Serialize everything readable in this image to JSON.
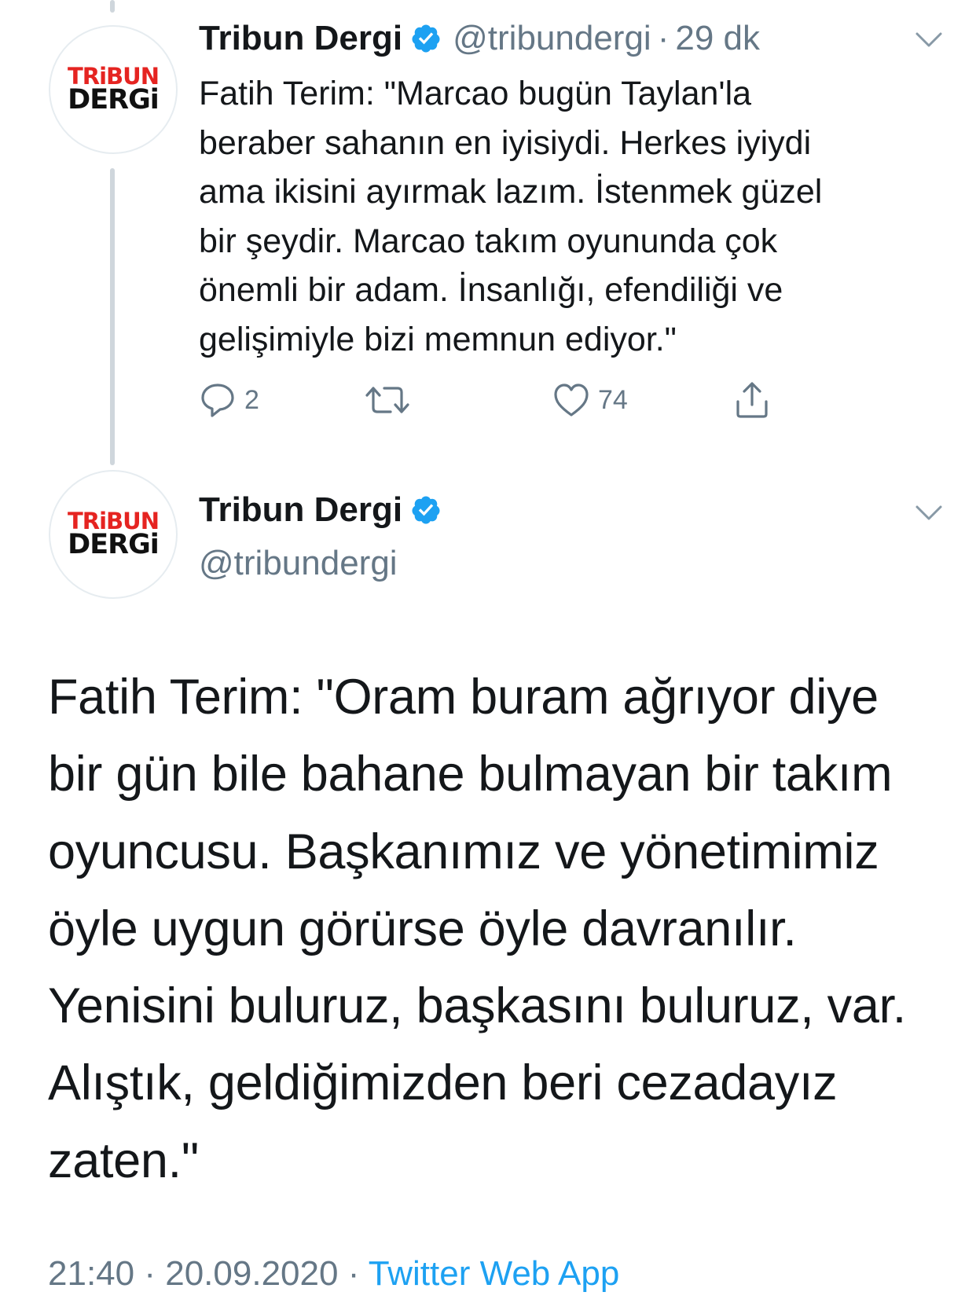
{
  "tweet1": {
    "avatar": {
      "logo_top": "TRiBUN",
      "logo_bottom": "DERGi"
    },
    "display_name": "Tribun Dergi",
    "handle": "@tribundergi",
    "separator": "·",
    "time_ago": "29 dk",
    "text": "Fatih Terim: \"Marcao bugün Taylan'la\nberaber sahanın en iyisiydi. Herkes iyiydi\nama ikisini ayırmak lazım. İstenmek güzel\nbir şeydir. Marcao takım oyununda çok\nönemli bir adam. İnsanlığı, efendiliği ve\ngelişimiyle bizi memnun ediyor.\"",
    "actions": {
      "reply_icon": "reply-icon",
      "reply_count": "2",
      "retweet_icon": "retweet-icon",
      "like_icon": "heart-icon",
      "like_count": "74",
      "share_icon": "share-icon"
    }
  },
  "tweet2": {
    "avatar": {
      "logo_top": "TRiBUN",
      "logo_bottom": "DERGi"
    },
    "display_name": "Tribun Dergi",
    "handle": "@tribundergi",
    "text": "Fatih Terim: \"Oram buram ağrıyor diye\nbir gün bile bahane bulmayan bir takım\noyuncusu. Başkanımız ve yönetimimiz\nöyle uygun görürse öyle davranılır.\nYenisini buluruz, başkasını buluruz, var.\nAlıştık, geldiğimizden beri cezadayız\nzaten.\"",
    "time": "21:40",
    "separator": "·",
    "date": "20.09.2020",
    "source": "Twitter Web App"
  },
  "colors": {
    "text": "#14171a",
    "secondary": "#657786",
    "accent": "#1da1f2",
    "thread_line": "#cfd6dc",
    "logo_red": "#e52421"
  }
}
